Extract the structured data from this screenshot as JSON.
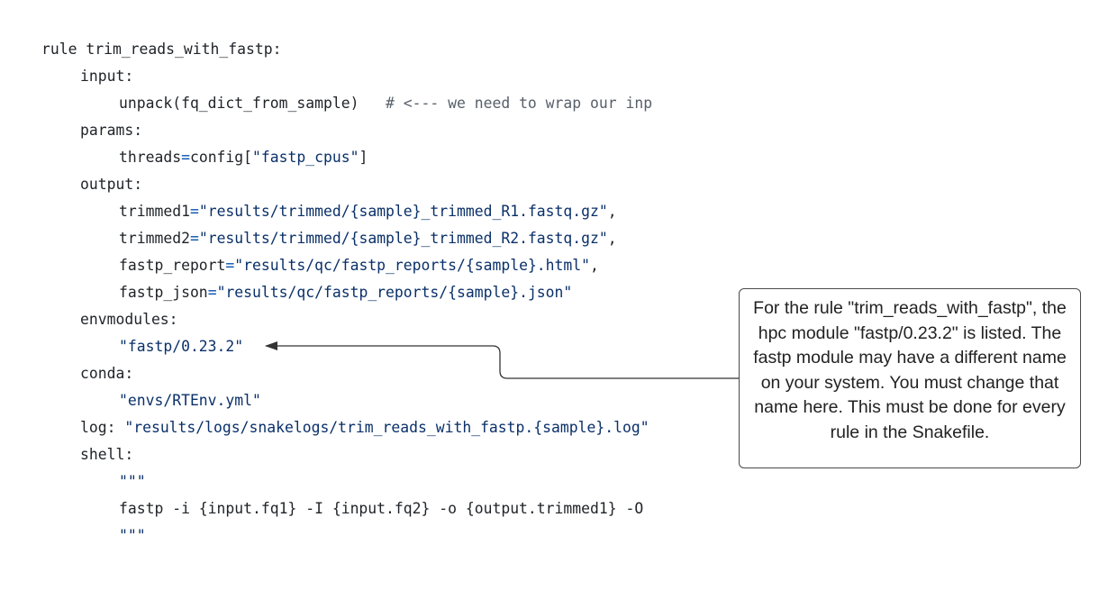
{
  "code": {
    "lines": [
      {
        "indent": 0,
        "tokens": [
          {
            "t": "plain",
            "v": "rule trim_reads_with_fastp:"
          }
        ]
      },
      {
        "indent": 1,
        "tokens": [
          {
            "t": "plain",
            "v": "input:"
          }
        ]
      },
      {
        "indent": 2,
        "tokens": [
          {
            "t": "plain",
            "v": "unpack(fq_dict_from_sample)   "
          },
          {
            "t": "com",
            "v": "# <--- we need to wrap our inp"
          }
        ]
      },
      {
        "indent": 1,
        "tokens": [
          {
            "t": "plain",
            "v": "params:"
          }
        ]
      },
      {
        "indent": 2,
        "tokens": [
          {
            "t": "plain",
            "v": "threads"
          },
          {
            "t": "op",
            "v": "="
          },
          {
            "t": "plain",
            "v": "config["
          },
          {
            "t": "str",
            "v": "\"fastp_cpus\""
          },
          {
            "t": "plain",
            "v": "]"
          }
        ]
      },
      {
        "indent": 1,
        "tokens": [
          {
            "t": "plain",
            "v": "output:"
          }
        ]
      },
      {
        "indent": 2,
        "tokens": [
          {
            "t": "plain",
            "v": "trimmed1"
          },
          {
            "t": "op",
            "v": "="
          },
          {
            "t": "str",
            "v": "\"results/trimmed/{sample}_trimmed_R1.fastq.gz\""
          },
          {
            "t": "plain",
            "v": ","
          }
        ]
      },
      {
        "indent": 2,
        "tokens": [
          {
            "t": "plain",
            "v": "trimmed2"
          },
          {
            "t": "op",
            "v": "="
          },
          {
            "t": "str",
            "v": "\"results/trimmed/{sample}_trimmed_R2.fastq.gz\""
          },
          {
            "t": "plain",
            "v": ","
          }
        ]
      },
      {
        "indent": 2,
        "tokens": [
          {
            "t": "plain",
            "v": "fastp_report"
          },
          {
            "t": "op",
            "v": "="
          },
          {
            "t": "str",
            "v": "\"results/qc/fastp_reports/{sample}.html\""
          },
          {
            "t": "plain",
            "v": ","
          }
        ]
      },
      {
        "indent": 2,
        "tokens": [
          {
            "t": "plain",
            "v": "fastp_json"
          },
          {
            "t": "op",
            "v": "="
          },
          {
            "t": "str",
            "v": "\"results/qc/fastp_reports/{sample}.json\""
          }
        ]
      },
      {
        "indent": 1,
        "tokens": [
          {
            "t": "plain",
            "v": "envmodules:"
          }
        ]
      },
      {
        "indent": 2,
        "tokens": [
          {
            "t": "str",
            "v": "\"fastp/0.23.2\""
          }
        ]
      },
      {
        "indent": 1,
        "tokens": [
          {
            "t": "plain",
            "v": "conda:"
          }
        ]
      },
      {
        "indent": 2,
        "tokens": [
          {
            "t": "str",
            "v": "\"envs/RTEnv.yml\""
          }
        ]
      },
      {
        "indent": 1,
        "tokens": [
          {
            "t": "plain",
            "v": "log: "
          },
          {
            "t": "str",
            "v": "\"results/logs/snakelogs/trim_reads_with_fastp.{sample}.log\""
          }
        ]
      },
      {
        "indent": 1,
        "tokens": [
          {
            "t": "plain",
            "v": "shell:"
          }
        ]
      },
      {
        "indent": 2,
        "tokens": [
          {
            "t": "str",
            "v": "\"\"\""
          }
        ]
      },
      {
        "indent": 2,
        "tokens": [
          {
            "t": "plain",
            "v": "fastp -i {input.fq1} -I {input.fq2} -o {output.trimmed1} -O"
          }
        ]
      },
      {
        "indent": 2,
        "tokens": [
          {
            "t": "str",
            "v": "\"\"\""
          }
        ]
      }
    ]
  },
  "annotation": {
    "text": "For the rule \"trim_reads_with_fastp\", the hpc module \"fastp/0.23.2\" is listed. The fastp module may have a different name on your system. You must change that name here. This must be done for every rule in the Snakefile."
  },
  "colors": {
    "string": "#0a3069",
    "operator": "#0550ae",
    "comment": "#57606a",
    "text": "#1f2328",
    "box_border": "#4a4a4a",
    "arrow": "#333333"
  }
}
